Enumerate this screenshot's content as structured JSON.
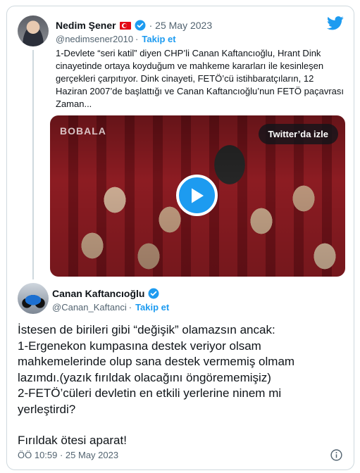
{
  "quoted_tweet": {
    "author_name": "Nedim Şener",
    "flag_icon": "turkey-flag-icon",
    "date": "25 May 2023",
    "handle": "@nedimsener2010",
    "follow_label": "Takip et",
    "text_lines": [
      "1-Devlete “seri katil” diyen CHP’li Canan Kaftancıoğlu, Hrant Dink",
      "cinayetinde ortaya koyduğum ve mahkeme kararları ile kesinleşen",
      "gerçekleri çarpıtıyor.  Dink cinayeti, FETÖ’cü istihbaratçıların, 12",
      "Haziran 2007’de başlattığı ve Canan Kaftancıoğlu’nun FETÖ paçavrası",
      "Zaman..."
    ],
    "video": {
      "logo_text": "BOBALA",
      "watch_label": "Twitter’da izle"
    }
  },
  "main_tweet": {
    "author_name": "Canan Kaftancıoğlu",
    "handle": "@Canan_Kaftanci",
    "follow_label": "Takip et",
    "text_lines": [
      "İstesen de birileri gibi “değişik” olamazsın ancak:",
      "1-Ergenekon kumpasına destek veriyor olsam",
      "mahkemelerinde olup sana destek vermemiş olmam",
      "lazımdı.(yazık fırıldak olacağını öngörememişiz)",
      "2-FETÖ’cüleri devletin en etkili yerlerine ninem mi",
      "yerleştirdi?",
      "",
      "Fırıldak ötesi aparat!"
    ],
    "timestamp": "ÖÖ 10:59 · 25 May 2023"
  },
  "colors": {
    "twitter_blue": "#1d9bf0",
    "secondary_text": "#536471",
    "border": "#cfd9de"
  }
}
